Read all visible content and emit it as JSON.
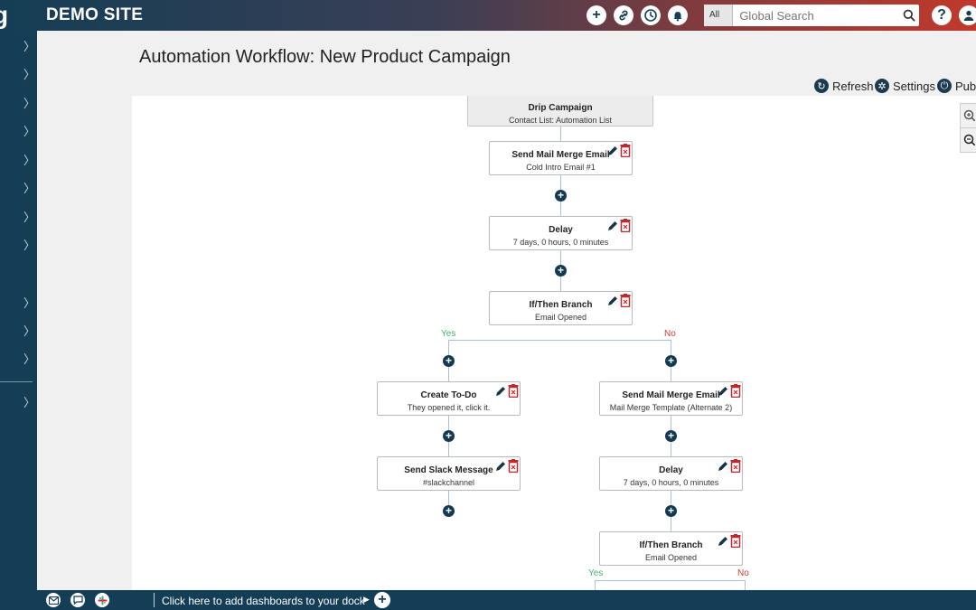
{
  "header": {
    "logo_text": "g",
    "site_name": "DEMO SITE",
    "icons": [
      "plus-icon",
      "link-icon",
      "clock-icon",
      "bell-icon",
      "help-icon",
      "user-icon"
    ],
    "search": {
      "scope": "All",
      "placeholder": "Global Search"
    }
  },
  "page": {
    "title": "Automation Workflow: New Product Campaign"
  },
  "toolbar": {
    "refresh_label": "Refresh",
    "settings_label": "Settings",
    "publish_label": "Publ"
  },
  "workflow": {
    "trigger": {
      "title": "Drip Campaign",
      "subtitle": "Contact List: Automation List"
    },
    "steps": [
      {
        "title": "Send Mail Merge Email",
        "subtitle": "Cold Intro Email #1"
      },
      {
        "title": "Delay",
        "subtitle": "7 days, 0 hours, 0 minutes"
      },
      {
        "title": "If/Then Branch",
        "subtitle": "Email Opened"
      }
    ],
    "yes_label": "Yes",
    "no_label": "No",
    "yes_branch": [
      {
        "title": "Create To-Do",
        "subtitle": "They opened it, click it."
      },
      {
        "title": "Send Slack Message",
        "subtitle": "#slackchannel"
      }
    ],
    "no_branch": [
      {
        "title": "Send Mail Merge Email",
        "subtitle": "Mail Merge Template (Alternate 2)"
      },
      {
        "title": "Delay",
        "subtitle": "7 days, 0 hours, 0 minutes"
      },
      {
        "title": "If/Then Branch",
        "subtitle": "Email Opened"
      }
    ],
    "sub_yes_label": "Yes",
    "sub_no_label": "No"
  },
  "dock": {
    "text": "Click here to add dashboards to your dock",
    "icons": [
      "mail-icon",
      "chat-icon",
      "slack-icon"
    ]
  },
  "colors": {
    "nav_dark": "#143e55",
    "header_red": "#c1392b",
    "yes_green": "#40b66b",
    "no_red": "#d23b35",
    "delete_red": "#c0282d"
  }
}
